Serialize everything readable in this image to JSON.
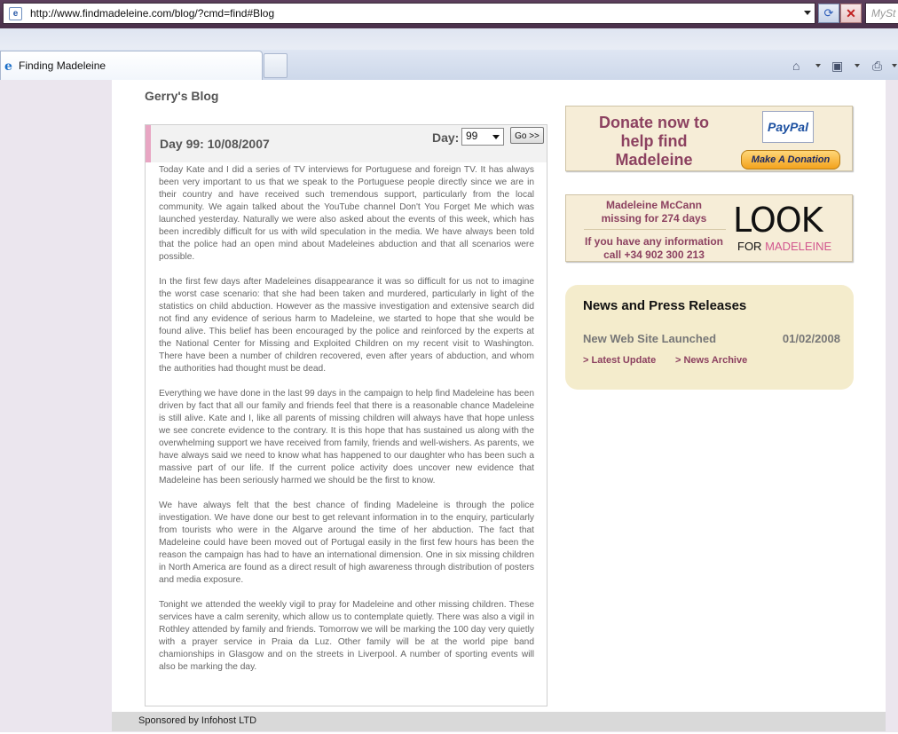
{
  "browser": {
    "url": "http://www.findmadeleine.com/blog/?cmd=find#Blog",
    "search_placeholder": "MySt",
    "tab_title": "Finding Madeleine",
    "icons": [
      "page-icon",
      "refresh-icon",
      "stop-icon",
      "home-icon",
      "rss-feed-icon",
      "print-icon"
    ]
  },
  "blog": {
    "title": "Gerry's Blog",
    "post_title": "Day 99: 10/08/2007",
    "day_label": "Day:",
    "day_value": "99",
    "go_label": "Go >>",
    "paragraphs": [
      "Today Kate and I did a series of TV interviews for Portuguese and foreign TV. It has always been very important to us that we speak to the Portuguese people directly since we are in their country and have received such tremendous support, particularly from the local community. We again talked about the YouTube channel Don't You Forget Me which was launched yesterday. Naturally we were also asked about the events of this week, which has been incredibly difficult for us with wild speculation in the media. We have always been told that the police had an open mind about Madeleines abduction and that all scenarios were possible.",
      "In the first few days after Madeleines disappearance it was so difficult for us not to imagine the worst case scenario: that she had been taken and murdered, particularly in light of the statistics on child abduction. However as the massive investigation and extensive search did not find any evidence of serious harm to Madeleine, we started to hope that she would be found alive. This belief has been encouraged by the police and reinforced by the experts at the National Center for Missing and Exploited Children on my recent visit to Washington. There have been a number of children recovered, even after years of abduction, and whom the authorities had thought must be dead.",
      "Everything we have done in the last 99 days in the campaign to help find Madeleine has been driven by fact that all our family and friends feel that there is a reasonable chance Madeleine is still alive. Kate and I, like all parents of missing children will always have that hope unless we see concrete evidence to the contrary. It is this hope that has sustained us along with the overwhelming support we have received from family, friends and well-wishers. As parents, we have always said we need to know what has happened to our daughter who has been such a massive part of our life. If the current police activity does uncover new evidence that Madeleine has been seriously harmed we should be the first to know.",
      "We have always felt that the best chance of finding Madeleine is through the police investigation. We have done our best to get relevant information in to the enquiry, particularly from tourists who were in the Algarve around the time of her abduction. The fact that Madeleine could have been moved out of Portugal easily in the first few hours has been the reason the campaign has had to have an international dimension. One in six missing children in North America are found as a direct result of high awareness through distribution of posters and media exposure.",
      "Tonight we attended the weekly vigil to pray for Madeleine and other missing children. These services have a calm serenity, which allow us to contemplate quietly. There was also a vigil in Rothley attended by family and friends. Tomorrow we will be marking the 100 day very quietly with a prayer service in Praia da Luz. Other family will be at the world pipe band chamionships in Glasgow and on the streets in Liverpool. A number of sporting events will also be marking the day."
    ]
  },
  "donate": {
    "line1": "Donate now to",
    "line2": "help find",
    "line3": "Madeleine",
    "paypal": "PayPal",
    "button": "Make A Donation"
  },
  "look": {
    "missing_line1": "Madeleine McCann",
    "missing_line2": "missing for 274 days",
    "info_line1": "If you have any information",
    "info_line2": "call +34 902 300 213",
    "logo": "LOOK",
    "sub_for": "FOR ",
    "sub_name": "MADELEINE"
  },
  "news": {
    "heading": "News and Press Releases",
    "item_title": "New Web Site Launched",
    "item_date": "01/02/2008",
    "link_latest": "> Latest Update",
    "link_archive": "> News Archive"
  },
  "footer": {
    "text": "Sponsored by Infohost LTD"
  },
  "colors": {
    "accent_pink": "#e8a6c3",
    "brand_maroon": "#8c4160",
    "panel_beige": "#f6edd7",
    "news_beige": "#f4eccc"
  }
}
